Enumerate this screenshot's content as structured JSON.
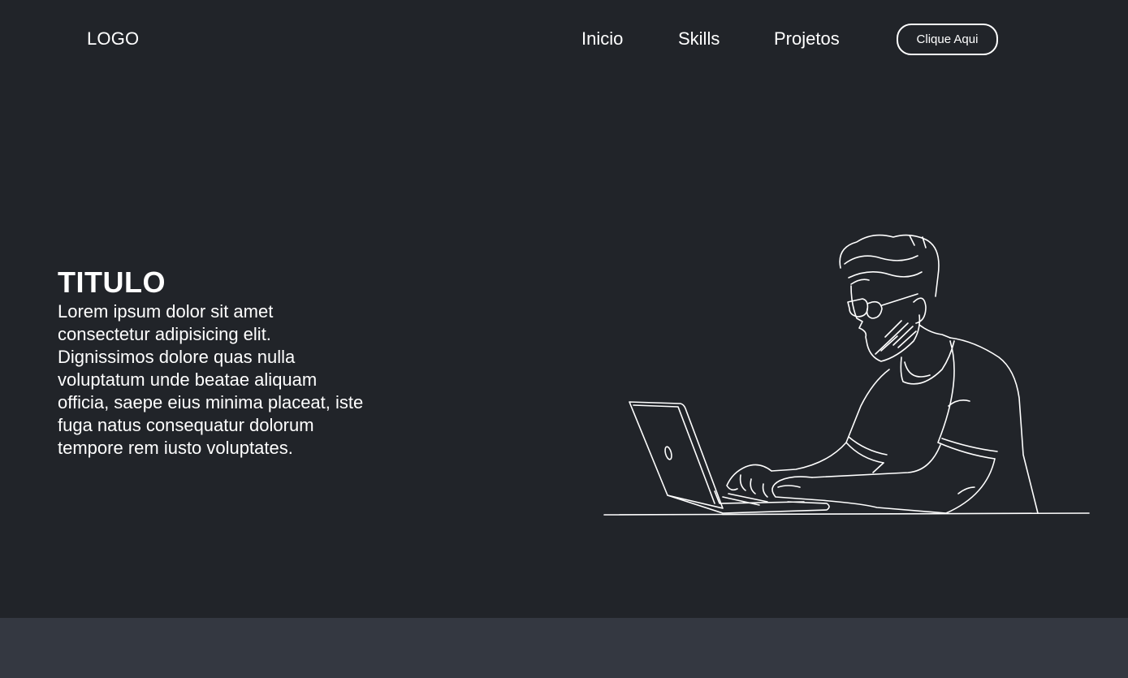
{
  "header": {
    "logo": "LOGO",
    "nav": [
      {
        "label": "Inicio"
      },
      {
        "label": "Skills"
      },
      {
        "label": "Projetos"
      }
    ],
    "cta_label": "Clique Aqui"
  },
  "hero": {
    "title": "TITULO",
    "description": "Lorem ipsum dolor sit amet consectetur adipisicing elit. Dignissimos dolore quas nulla voluptatum unde beatae aliquam officia, saepe eius minima placeat, iste fuga natus consequatur dolorum tempore rem iusto voluptates.",
    "illustration_icon": "developer-at-laptop-illustration"
  },
  "colors": {
    "hero_background": "#212429",
    "below_background": "#343841",
    "text": "#ffffff"
  }
}
